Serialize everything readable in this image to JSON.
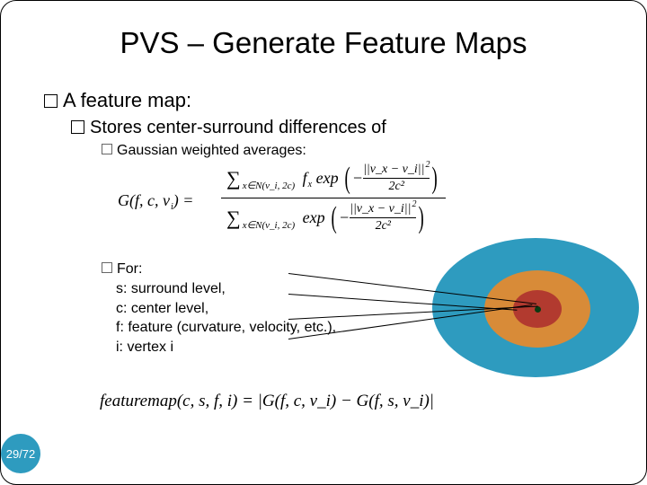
{
  "title": "PVS – Generate Feature Maps",
  "b1": "A feature map:",
  "b2": "Stores center-surround differences of",
  "b3": "Gaussian weighted averages:",
  "b4": "For:",
  "defs": {
    "s": "s: surround level,",
    "c": "c: center level,",
    "f": "f: feature (curvature, velocity, etc.),",
    "i": "i: vertex i"
  },
  "formula1": {
    "lhs": "G(f, c, v_i) =",
    "sum_sub": "x∈N(v_i, 2c)",
    "num_factor": "f_x exp",
    "den_factor": "exp",
    "inner_num": "||v_x − v_i||",
    "inner_den": "2c²",
    "neg": "−"
  },
  "formula2": "featuremap(c, s, f, i) = |G(f, c, v_i) − G(f, s, v_i)|",
  "pager": "29/72",
  "diagram": {
    "outer_color": "#2e9bbf",
    "mid_color": "#d88b38",
    "inner_color": "#b23a2f",
    "dot_color": "#0a3a12"
  }
}
